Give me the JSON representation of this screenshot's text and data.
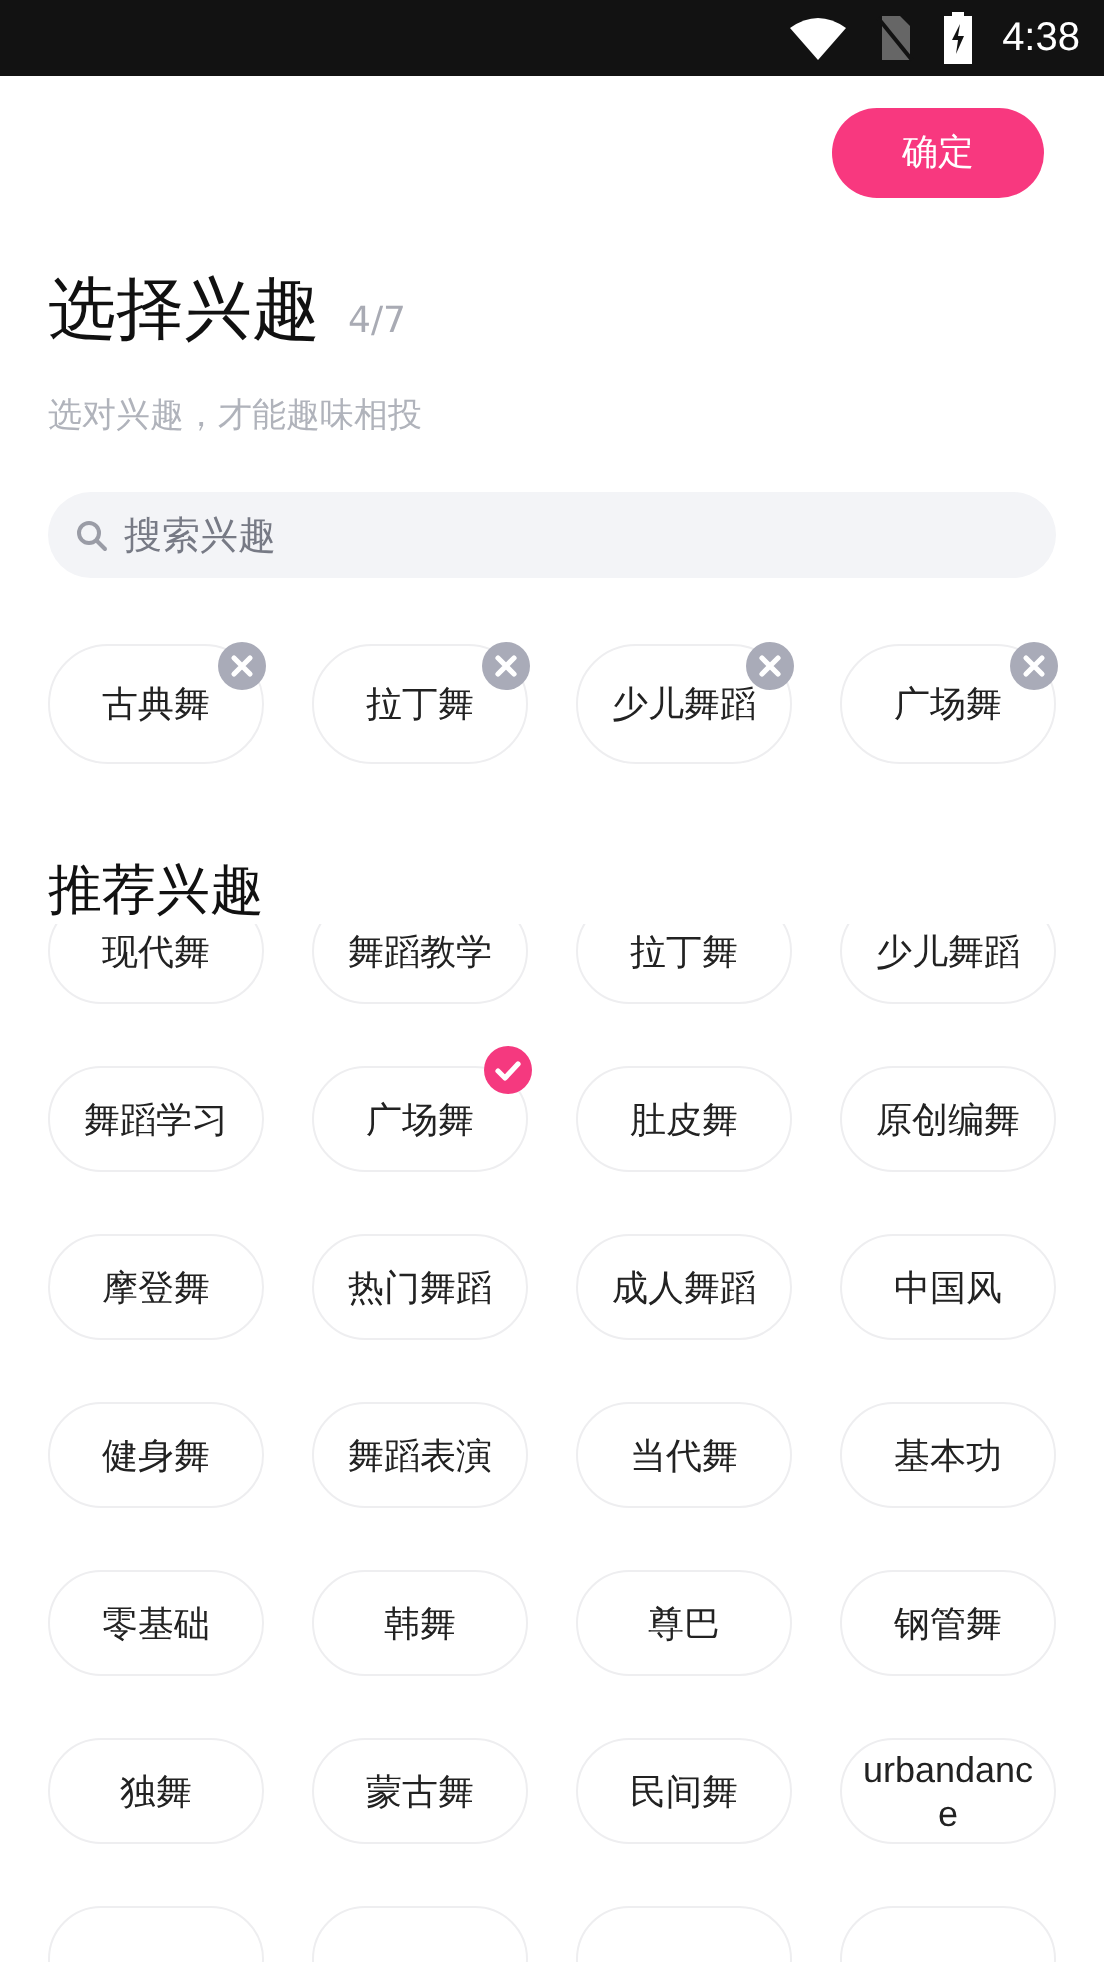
{
  "status_bar": {
    "time": "4:38"
  },
  "confirm_button": "确定",
  "title": "选择兴趣",
  "count": "4/7",
  "subtitle": "选对兴趣，才能趣味相投",
  "search": {
    "placeholder": "搜索兴趣"
  },
  "selected_interests": [
    {
      "label": "古典舞"
    },
    {
      "label": "拉丁舞"
    },
    {
      "label": "少儿舞蹈"
    },
    {
      "label": "广场舞"
    }
  ],
  "recommended_title": "推荐兴趣",
  "recommended": [
    {
      "kind": "chip",
      "label": "现代舞",
      "selected": false
    },
    {
      "kind": "chip",
      "label": "舞蹈教学",
      "selected": false
    },
    {
      "kind": "chip",
      "label": "拉丁舞",
      "selected": false
    },
    {
      "kind": "chip",
      "label": "少儿舞蹈",
      "selected": false
    },
    {
      "kind": "chip",
      "label": "舞蹈学习",
      "selected": false
    },
    {
      "kind": "chip",
      "label": "广场舞",
      "selected": true
    },
    {
      "kind": "chip",
      "label": "肚皮舞",
      "selected": false
    },
    {
      "kind": "chip",
      "label": "原创编舞",
      "selected": false
    },
    {
      "kind": "chip",
      "label": "摩登舞",
      "selected": false
    },
    {
      "kind": "chip",
      "label": "热门舞蹈",
      "selected": false
    },
    {
      "kind": "chip",
      "label": "成人舞蹈",
      "selected": false
    },
    {
      "kind": "chip",
      "label": "中国风",
      "selected": false
    },
    {
      "kind": "chip",
      "label": "健身舞",
      "selected": false
    },
    {
      "kind": "chip",
      "label": "舞蹈表演",
      "selected": false
    },
    {
      "kind": "chip",
      "label": "当代舞",
      "selected": false
    },
    {
      "kind": "chip",
      "label": "基本功",
      "selected": false
    },
    {
      "kind": "chip",
      "label": "零基础",
      "selected": false
    },
    {
      "kind": "chip",
      "label": "韩舞",
      "selected": false
    },
    {
      "kind": "chip",
      "label": "尊巴",
      "selected": false
    },
    {
      "kind": "chip",
      "label": "钢管舞",
      "selected": false
    },
    {
      "kind": "chip",
      "label": "独舞",
      "selected": false
    },
    {
      "kind": "chip",
      "label": "蒙古舞",
      "selected": false
    },
    {
      "kind": "chip",
      "label": "民间舞",
      "selected": false
    },
    {
      "kind": "chip",
      "label": "urbandance",
      "selected": false
    },
    {
      "kind": "cut"
    },
    {
      "kind": "cut"
    },
    {
      "kind": "cut"
    },
    {
      "kind": "cut"
    }
  ]
}
